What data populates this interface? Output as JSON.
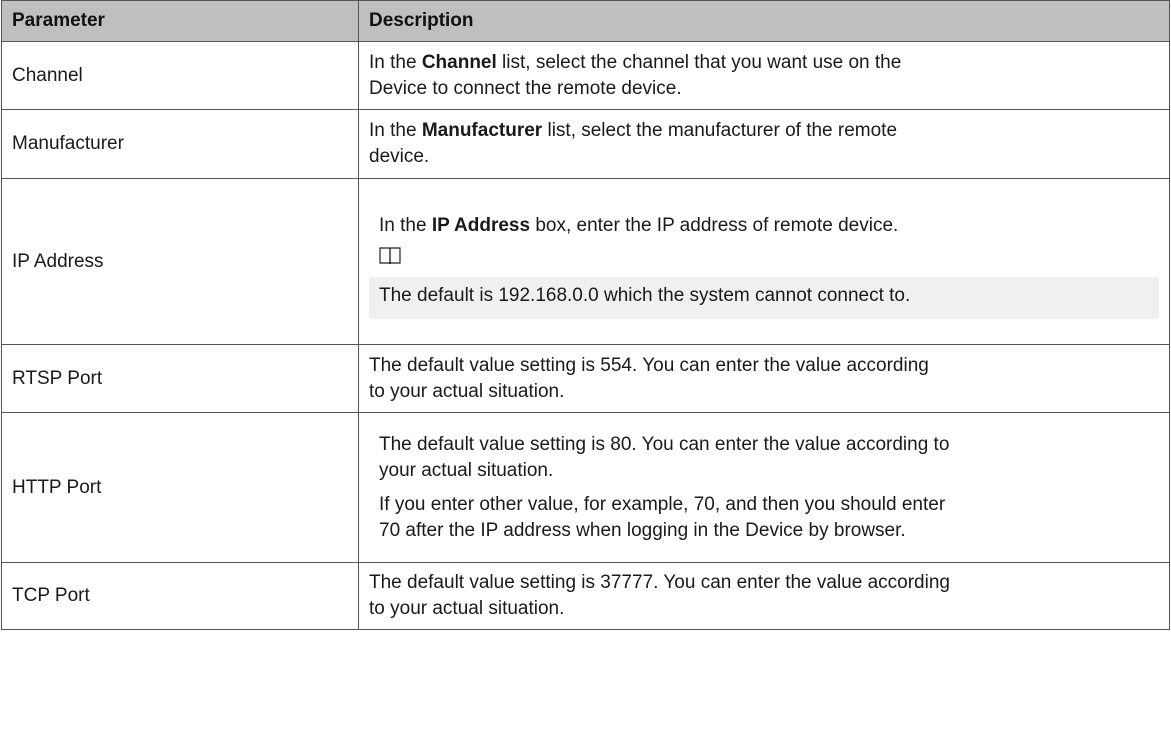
{
  "table": {
    "header": {
      "parameter": "Parameter",
      "description": "Description"
    },
    "rows": [
      {
        "parameter": "Channel",
        "desc_pre": "In the ",
        "desc_bold": "Channel",
        "desc_post": "  list, select the channel that you want use on the",
        "desc_line2": "Device to connect the remote device."
      },
      {
        "parameter": "Manufacturer",
        "desc_pre": "In the ",
        "desc_bold": "Manufacturer",
        "desc_post": "  list, select the manufacturer of the remote",
        "desc_line2": "device."
      },
      {
        "parameter": "IP Address",
        "desc_pre": "In the ",
        "desc_bold": "IP Address",
        "desc_post": "  box, enter the IP address of remote device.",
        "note_icon": "book-icon",
        "note": "The default is 192.168.0.0 which the system cannot connect to."
      },
      {
        "parameter": "RTSP Port",
        "desc_line1": "The default value setting is 554. You can enter the value according",
        "desc_line2": "to your actual situation."
      },
      {
        "parameter": "HTTP Port",
        "desc_line1": "The default value setting is 80. You can enter the value according to",
        "desc_line2": "your actual situation.",
        "desc_line3": "If you enter other value, for example, 70, and then you should enter",
        "desc_line4": "70 after the IP address when logging in the Device by browser."
      },
      {
        "parameter": "TCP Port",
        "desc_line1": "The default value setting is 37777. You can enter the value according",
        "desc_line2": "to your actual situation."
      }
    ]
  }
}
